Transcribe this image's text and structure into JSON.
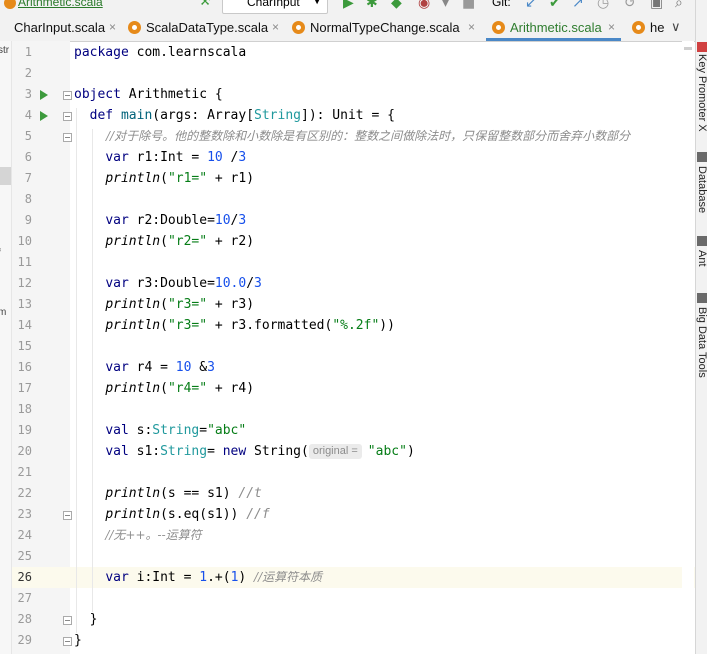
{
  "toolbar": {
    "breadcrumb": "Arithmetic.scala",
    "run_config": "CharInput",
    "git_label": "Git:"
  },
  "tabs": [
    {
      "label": "CharInput.scala",
      "active": false
    },
    {
      "label": "ScalaDataType.scala",
      "active": false
    },
    {
      "label": "NormalTypeChange.scala",
      "active": false
    },
    {
      "label": "Arithmetic.scala",
      "active": true
    },
    {
      "label": "he",
      "active": false
    }
  ],
  "tab_close_glyph": "×",
  "tab_more_glyph": "∨",
  "left_panel": {
    "fragments": [
      "str",
      "f",
      "m"
    ]
  },
  "line_numbers": [
    "1",
    "2",
    "3",
    "4",
    "5",
    "6",
    "7",
    "8",
    "9",
    "10",
    "11",
    "12",
    "13",
    "14",
    "15",
    "16",
    "17",
    "18",
    "19",
    "20",
    "21",
    "22",
    "23",
    "24",
    "25",
    "26",
    "27",
    "28",
    "29"
  ],
  "code": {
    "l1_pkg": "package",
    "l1_name": " com.learnscala",
    "l3_obj": "object",
    "l3_name": " Arithmetic {",
    "l4_def": "def",
    "l4_main": "main",
    "l4_rest1": "(args: Array[",
    "l4_string": "String",
    "l4_rest2": "]): Unit = {",
    "l5_comment": "//对于除号。他的整数除和小数除是有区别的：整数之间做除法时，只保留整数部分而舍弃小数部分",
    "l6_var": "var",
    "l6_a": " r1:Int = ",
    "l6_n1": "10",
    "l6_op": " /",
    "l6_n2": "3",
    "l7_println": "println",
    "l7_a": "(",
    "l7_str": "\"r1=\"",
    "l7_b": " + r1)",
    "l9_var": "var",
    "l9_a": " r2:Double=",
    "l9_n1": "10",
    "l9_op": "/",
    "l9_n2": "3",
    "l10_println": "println",
    "l10_a": "(",
    "l10_str": "\"r2=\"",
    "l10_b": " + r2)",
    "l12_var": "var",
    "l12_a": " r3:Double=",
    "l12_n1": "10.0",
    "l12_op": "/",
    "l12_n2": "3",
    "l13_println": "println",
    "l13_a": "(",
    "l13_str": "\"r3=\"",
    "l13_b": " + r3)",
    "l14_println": "println",
    "l14_a": "(",
    "l14_str": "\"r3=\"",
    "l14_b": " + r3.formatted(",
    "l14_str2": "\"%.2f\"",
    "l14_c": "))",
    "l16_var": "var",
    "l16_a": " r4 = ",
    "l16_n1": "10",
    "l16_op": " &",
    "l16_n2": "3",
    "l17_println": "println",
    "l17_a": "(",
    "l17_str": "\"r4=\"",
    "l17_b": " + r4)",
    "l19_val": "val",
    "l19_a": " s:",
    "l19_type": "String",
    "l19_b": "=",
    "l19_str": "\"abc\"",
    "l20_val": "val",
    "l20_a": " s1:",
    "l20_type": "String",
    "l20_b": "= ",
    "l20_new": "new",
    "l20_c": " String(",
    "l20_hint": "original =",
    "l20_str": "\"abc\"",
    "l20_d": ")",
    "l22_println": "println",
    "l22_a": "(s == s1) ",
    "l22_cm": "//t",
    "l23_println": "println",
    "l23_a": "(s.eq(s1)) ",
    "l23_cm": "//f",
    "l24_cm": "//无++。--运算符",
    "l26_var": "var",
    "l26_a": " i:Int = ",
    "l26_n1": "1",
    "l26_b": ".+(",
    "l26_n2": "1",
    "l26_c": ") ",
    "l26_cm": "//运算符本质",
    "l28_close": "}",
    "l29_close": "}"
  },
  "right_tools": [
    {
      "label": "Key Promoter X"
    },
    {
      "label": "Database"
    },
    {
      "label": "Ant"
    },
    {
      "label": "Big Data Tools"
    }
  ],
  "colors": {
    "keyword": "#000080",
    "number": "#1750eb",
    "string": "#067d17",
    "type": "#20999d",
    "comment": "#8c8c8c",
    "active_tab": "#2f7d2f",
    "run_icon": "#3c9a3c"
  }
}
